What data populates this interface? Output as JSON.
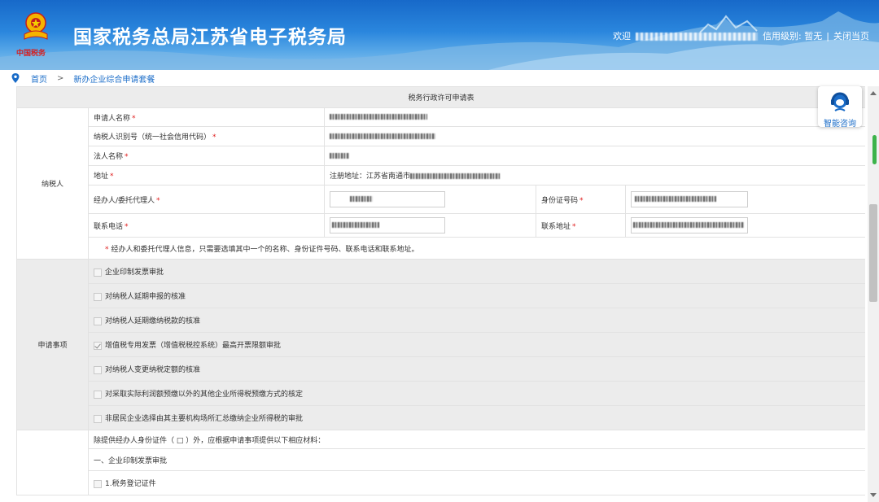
{
  "header": {
    "site_title": "国家税务总局江苏省电子税务局",
    "emblem_text": "中国税务",
    "welcome": "欢迎",
    "credit_label": "信用级别:",
    "credit_value": "暂无",
    "close_link": "关闭当页",
    "separator": "|"
  },
  "breadcrumb": {
    "home": "首页",
    "separator": ">",
    "current": "新办企业综合申请套餐"
  },
  "form": {
    "title": "税务行政许可申请表",
    "taxpayer_section": "纳税人",
    "fields": {
      "applicant_name": "申请人名称",
      "taxpayer_id": "纳税人识别号（统一社会信用代码）",
      "legal_person": "法人名称",
      "address": "地址",
      "agent": "经办人/委托代理人",
      "id_number": "身份证号码",
      "phone": "联系电话",
      "contact_address": "联系地址"
    },
    "required_mark": "*",
    "address_value_prefix": "注册地址：江苏省南通市",
    "note": "经办人和委托代理人信息，只需要选填其中一个的名称、身份证件号码、联系电话和联系地址。",
    "matters_section": "申请事项",
    "matters": [
      {
        "label": "企业印制发票审批",
        "checked": false
      },
      {
        "label": "对纳税人延期申报的核准",
        "checked": false
      },
      {
        "label": "对纳税人延期缴纳税款的核准",
        "checked": false
      },
      {
        "label": "增值税专用发票（增值税税控系统）最高开票限额审批",
        "checked": true
      },
      {
        "label": "对纳税人变更纳税定额的核准",
        "checked": false
      },
      {
        "label": "对采取实际利润额预缴以外的其他企业所得税预缴方式的核定",
        "checked": false
      },
      {
        "label": "非居民企业选择由其主要机构场所汇总缴纳企业所得税的审批",
        "checked": false
      }
    ],
    "materials_intro": "除提供经办人身份证件（ □ ）外，应根据申请事项提供以下相应材料：",
    "materials_heading": "一、企业印制发票审批",
    "materials_item_1": "1.税务登记证件"
  },
  "smart_consult": {
    "label": "智能咨询"
  },
  "colors": {
    "link_blue": "#1a6cc8",
    "required_red": "#e02020",
    "header_blue": "#1769c9",
    "section_gray": "#ececec"
  }
}
